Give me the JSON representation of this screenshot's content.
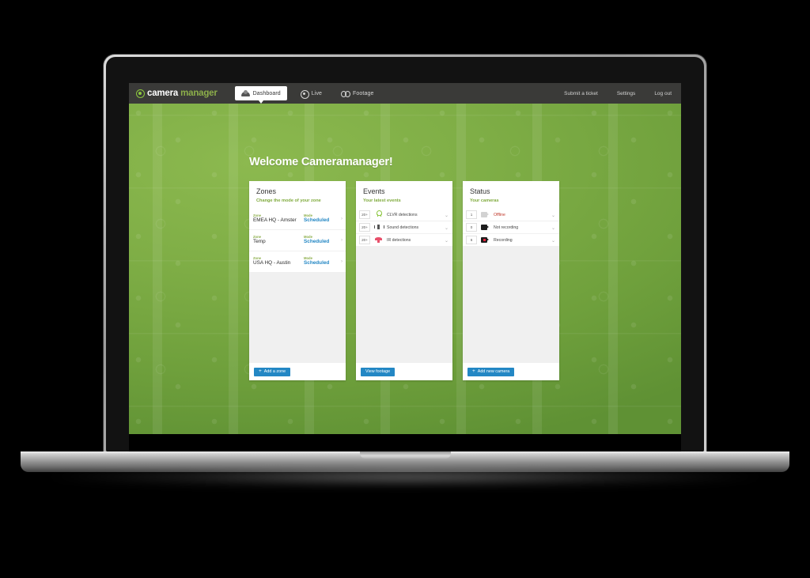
{
  "brand": {
    "name_part1": "camera",
    "name_part2": "manager",
    "logo_icon": "circle-lens-icon"
  },
  "topnav": {
    "primary": [
      {
        "label": "Dashboard",
        "icon": "dashboard-icon",
        "active": true
      },
      {
        "label": "Live",
        "icon": "live-circle-icon",
        "active": false
      },
      {
        "label": "Footage",
        "icon": "binoculars-icon",
        "active": false
      }
    ],
    "secondary": [
      {
        "label": "Submit a ticket"
      },
      {
        "label": "Settings"
      },
      {
        "label": "Log out"
      }
    ]
  },
  "page": {
    "title": "Welcome Cameramanager!"
  },
  "panels": {
    "zones": {
      "title": "Zones",
      "subtitle": "Change the mode of your zone",
      "zone_label": "Zone",
      "mode_label": "Mode",
      "rows": [
        {
          "zone": "EMEA HQ - Amster",
          "mode": "Scheduled"
        },
        {
          "zone": "Temp",
          "mode": "Scheduled"
        },
        {
          "zone": "USA HQ - Austin",
          "mode": "Scheduled"
        }
      ],
      "button": "Add a zone",
      "button_plus": "+"
    },
    "events": {
      "title": "Events",
      "subtitle": "Your latest events",
      "rows": [
        {
          "count": "20+",
          "label": "CLVR detections",
          "icon": "lightbulb-icon"
        },
        {
          "count": "20+",
          "label": "Sound detections",
          "icon": "sound-wave-icon"
        },
        {
          "count": "20+",
          "label": "IR detections",
          "icon": "ir-beam-icon"
        }
      ],
      "button": "View footage"
    },
    "status": {
      "title": "Status",
      "subtitle": "Your cameras",
      "rows": [
        {
          "count": "1",
          "label": "Offline",
          "icon": "camera-offline-icon",
          "state": "offline"
        },
        {
          "count": "0",
          "label": "Not recording",
          "icon": "camera-icon",
          "state": "notrec"
        },
        {
          "count": "6",
          "label": "Recording",
          "icon": "camera-recording-icon",
          "state": "rec"
        }
      ],
      "button": "Add new camera",
      "button_plus": "+"
    }
  },
  "colors": {
    "brand_green": "#8cc63f",
    "accent_blue": "#2387c4",
    "offline_red": "#c0392b",
    "nav_dark": "#3a3a38",
    "desktop_green": "#7fae46"
  }
}
